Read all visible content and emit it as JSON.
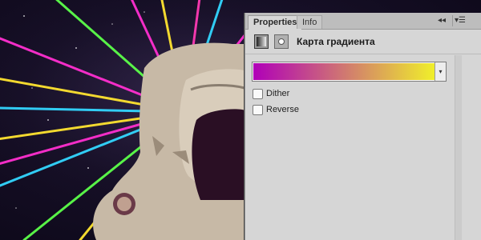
{
  "panel": {
    "tabs": [
      {
        "label": "Properties",
        "active": true
      },
      {
        "label": "Info",
        "active": false
      }
    ],
    "collapse_glyph": "◂◂",
    "menu_glyph": "▾☰",
    "mode_icons": [
      "gradient-map-icon",
      "layer-mask-icon"
    ],
    "title": "Карта градиента",
    "gradient": {
      "stops": [
        "#b000b8",
        "#f0f02a"
      ],
      "dropdown_glyph": "▾"
    },
    "options": {
      "dither": {
        "label": "Dither",
        "checked": false
      },
      "reverse": {
        "label": "Reverse",
        "checked": false
      }
    }
  },
  "colors": {
    "panel_bg": "#d6d6d6",
    "laser_colors": [
      "#ff2fd0",
      "#ffe430",
      "#33d7ff",
      "#ff3ab4",
      "#5cff4a"
    ]
  }
}
